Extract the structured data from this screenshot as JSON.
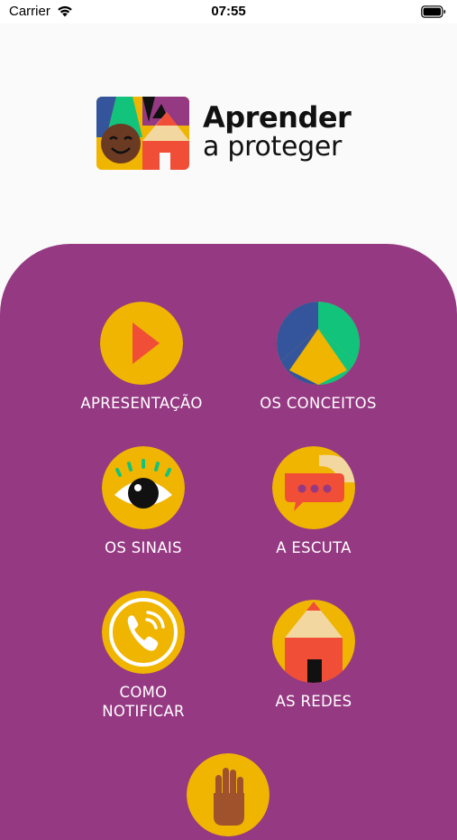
{
  "status_bar": {
    "carrier": "Carrier",
    "time": "07:55"
  },
  "logo": {
    "line1": "Aprender",
    "line2": "a proteger"
  },
  "colors": {
    "panel": "#953982",
    "icon_circle": "#f0b500",
    "accent_red": "#f04e37",
    "blue": "#34559b",
    "green": "#12c37c"
  },
  "menu": {
    "items": [
      {
        "id": "apresentacao",
        "label": "APRESENTAÇÃO",
        "icon": "play-icon"
      },
      {
        "id": "conceitos",
        "label": "OS CONCEITOS",
        "icon": "conceitos-icon"
      },
      {
        "id": "sinais",
        "label": "OS SINAIS",
        "icon": "eye-icon"
      },
      {
        "id": "escuta",
        "label": "A ESCUTA",
        "icon": "chat-bubble-icon"
      },
      {
        "id": "notificar",
        "label_line1": "COMO",
        "label_line2": "NOTIFICAR",
        "icon": "phone-icon"
      },
      {
        "id": "redes",
        "label": "AS REDES",
        "icon": "house-icon"
      },
      {
        "id": "extra",
        "icon": "hand-icon"
      }
    ]
  }
}
